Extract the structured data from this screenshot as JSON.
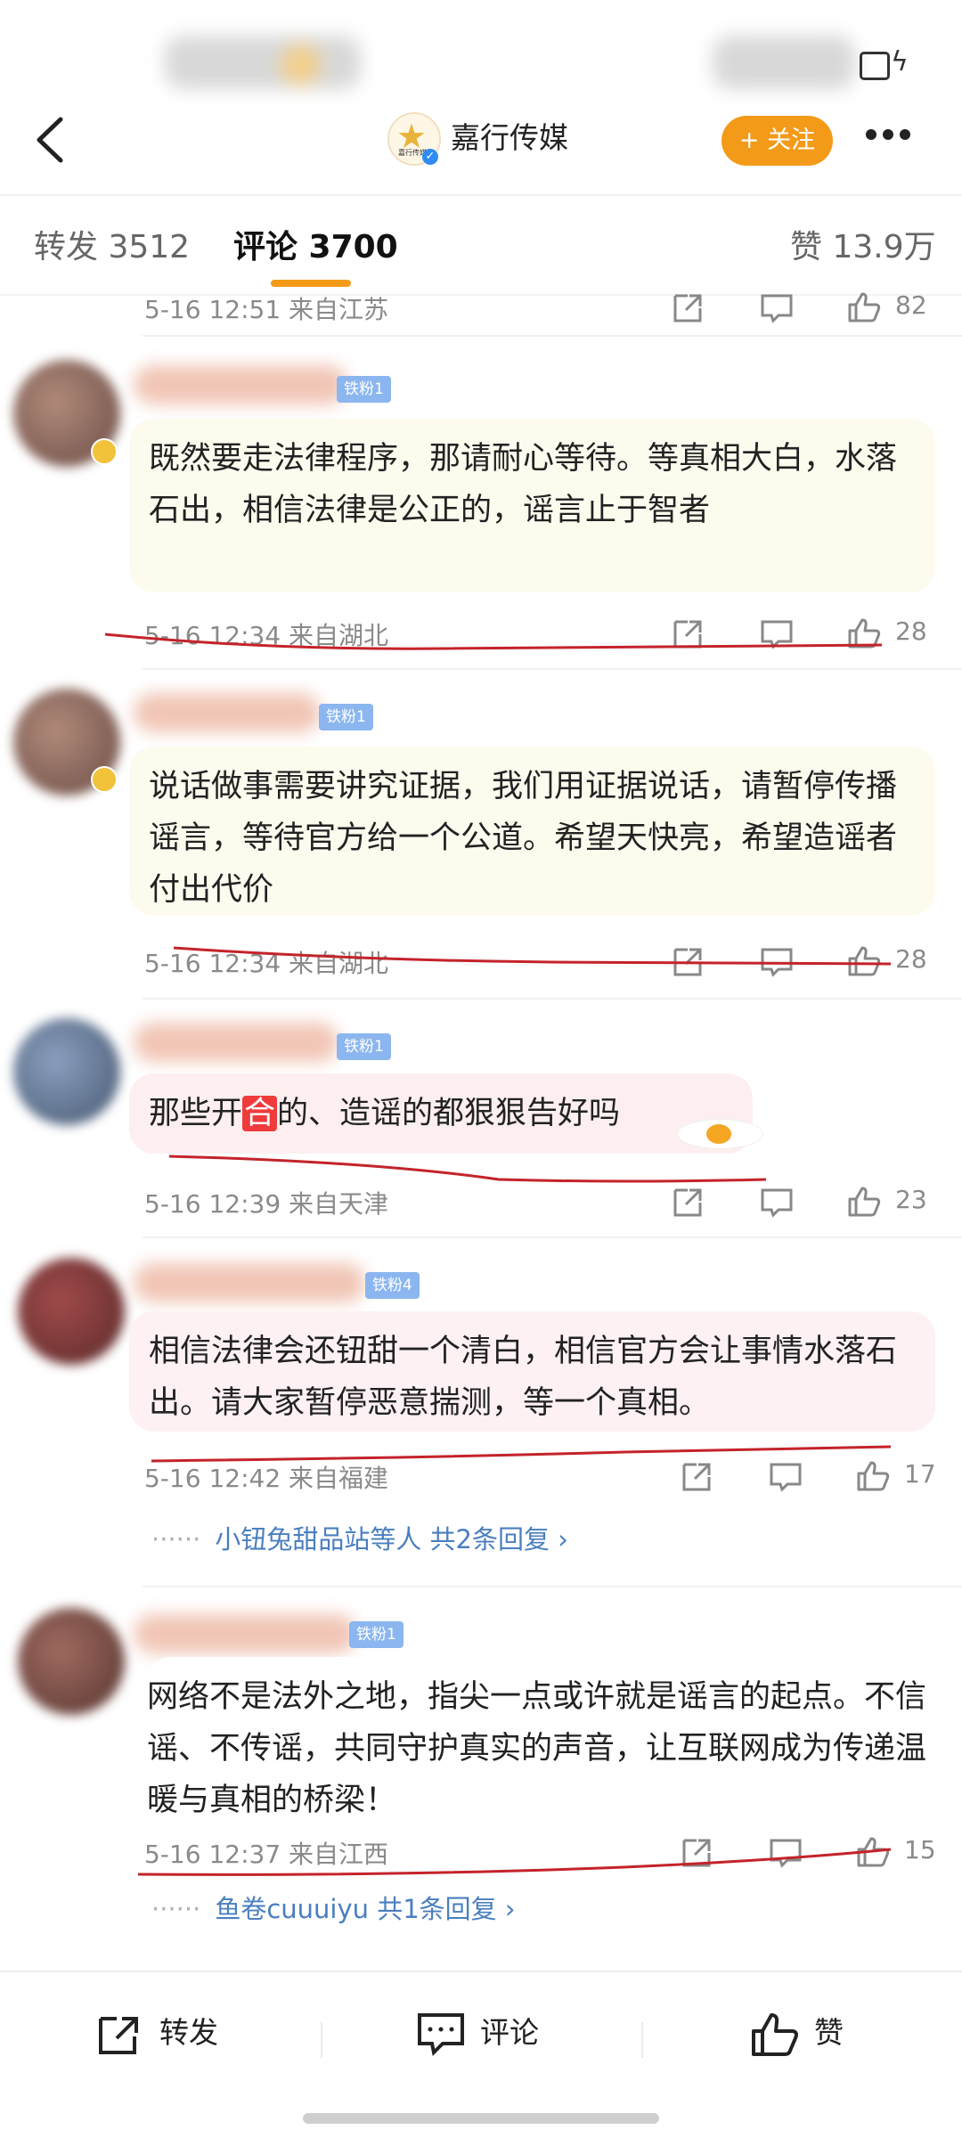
{
  "header": {
    "account_name": "嘉行传媒",
    "logo_text": "嘉行传媒",
    "follow_label": "+ 关注"
  },
  "tabs": {
    "repost": "转发 3512",
    "comments": "评论 3700",
    "likes": "赞 13.9万"
  },
  "top_meta": {
    "time_loc": "5-16 12:51 来自江苏",
    "likes": "82"
  },
  "comments": [
    {
      "badge": "铁粉1",
      "text": "既然要走法律程序，那请耐心等待。等真相大白，水落石出，相信法律是公正的，谣言止于智者",
      "time_loc": "5-16 12:34 来自湖北",
      "likes": "28"
    },
    {
      "badge": "铁粉1",
      "text": "说话做事需要讲究证据，我们用证据说话，请暂停传播谣言，等待官方给一个公道。希望天快亮，希望造谣者付出代价",
      "time_loc": "5-16 12:34 来自湖北",
      "likes": "28"
    },
    {
      "badge": "铁粉1",
      "text_before": "那些开",
      "text_highlight": "合",
      "text_after": "的、造谣的都狠狠告好吗",
      "time_loc": "5-16 12:39 来自天津",
      "likes": "23"
    },
    {
      "badge": "铁粉4",
      "text": "相信法律会还钮甜一个清白，相信官方会让事情水落石出。请大家暂停恶意揣测，等一个真相。",
      "time_loc": "5-16 12:42 来自福建",
      "likes": "17",
      "replies": "小钮兔甜品站等人  共2条回复 ›"
    },
    {
      "badge": "铁粉1",
      "text": "网络不是法外之地，指尖一点或许就是谣言的起点。不信谣、不传谣，共同守护真实的声音，让互联网成为传递温暖与真相的桥梁！",
      "time_loc": "5-16 12:37 来自江西",
      "likes": "15",
      "replies": "鱼卷cuuuiyu  共1条回复 ›"
    }
  ],
  "bottom_bar": {
    "repost": "转发",
    "comment": "评论",
    "like": "赞"
  },
  "colors": {
    "accent": "#f39a18",
    "link": "#4a7fbf",
    "annotation_red": "#c4232b"
  }
}
